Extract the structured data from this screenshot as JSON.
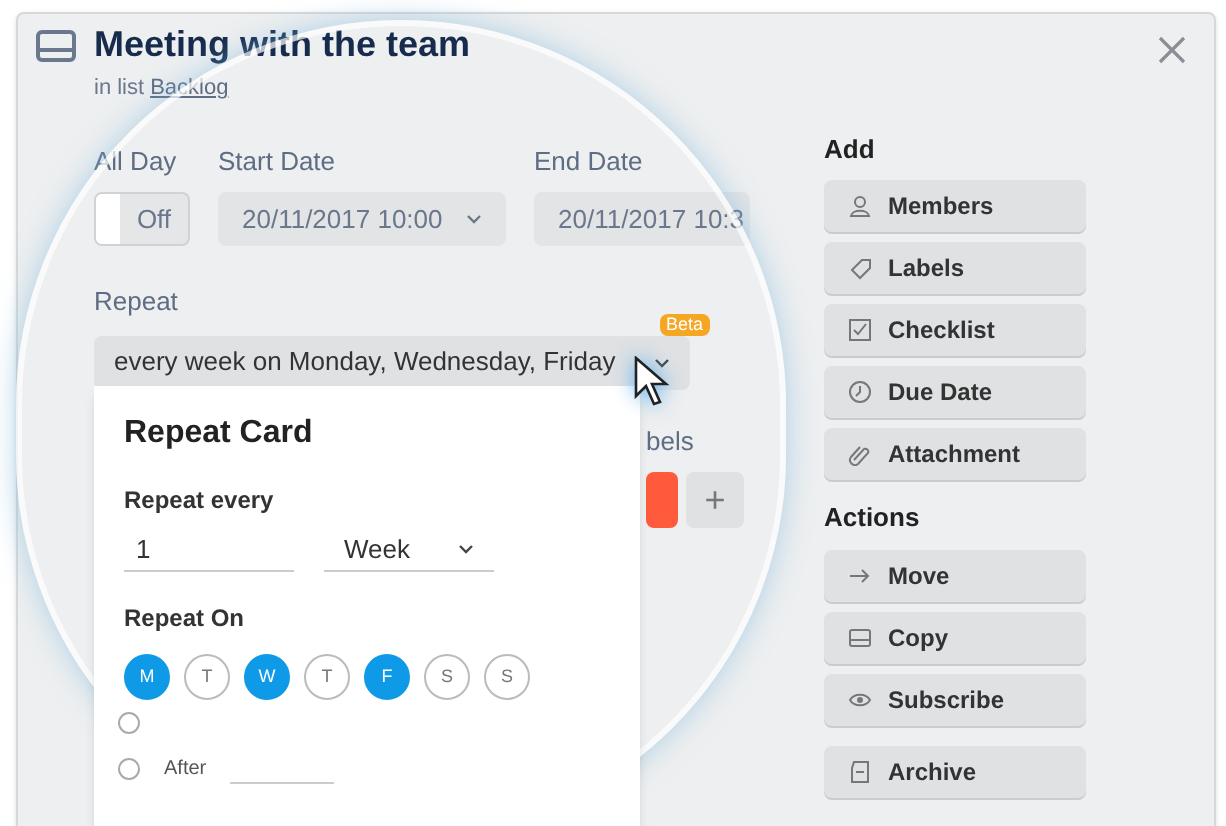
{
  "card": {
    "title": "Meeting with the team",
    "list_prefix": "in list",
    "list_name": "Backlog"
  },
  "dates": {
    "all_day_label": "All Day",
    "all_day": {
      "on": false,
      "label": "Off"
    },
    "start_label": "Start Date",
    "start_value": "20/11/2017 10:00",
    "end_label": "End Date",
    "end_value": "20/11/2017 10:3"
  },
  "repeat": {
    "label": "Repeat",
    "value": "every week on Monday, Wednesday, Friday",
    "badge": "Beta"
  },
  "labels_section": {
    "heading": "bels",
    "labels": [
      {
        "color": "#ff5a3c"
      }
    ],
    "add": "+"
  },
  "repeat_card": {
    "title": "Repeat Card",
    "every_label": "Repeat every",
    "every_value": "1",
    "unit": "Week",
    "on_label": "Repeat On",
    "days": [
      {
        "label": "M",
        "selected": true
      },
      {
        "label": "T",
        "selected": false
      },
      {
        "label": "W",
        "selected": true
      },
      {
        "label": "T",
        "selected": false
      },
      {
        "label": "F",
        "selected": true
      },
      {
        "label": "S",
        "selected": false
      },
      {
        "label": "S",
        "selected": false
      }
    ],
    "ends": [
      {
        "selected": false
      },
      {
        "label": "After",
        "selected": false
      }
    ]
  },
  "sidebar": {
    "sections": [
      {
        "heading": "Add",
        "items": [
          {
            "label": "Members"
          },
          {
            "label": "Labels"
          },
          {
            "label": "Checklist"
          },
          {
            "label": "Due Date"
          },
          {
            "label": "Attachment"
          }
        ]
      },
      {
        "heading": "Actions",
        "items": [
          {
            "label": "Move"
          },
          {
            "label": "Copy"
          },
          {
            "label": "Subscribe"
          },
          {
            "label": "Archive"
          }
        ]
      }
    ]
  }
}
